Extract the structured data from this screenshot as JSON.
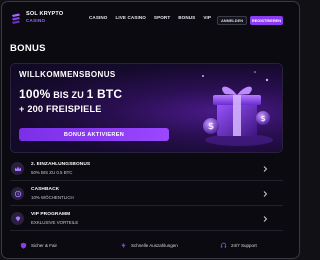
{
  "header": {
    "logo_name": "SOL KRYPTO",
    "logo_sub": "CASINO",
    "nav": [
      "CASINO",
      "LIVE CASINO",
      "SPORT",
      "BONUS",
      "VIP"
    ],
    "login_label": "ANMELDEN",
    "register_label": "REGISTRIEREN"
  },
  "page_title": "BONUS",
  "hero": {
    "title": "WILLKOMMENSBONUS",
    "line1_a": "100%",
    "line1_b": " BIS ZU ",
    "line1_c": "1 BTC",
    "line2": "+ 200 FREISPIELE",
    "cta_label": "BONUS AKTIVIEREN"
  },
  "offers": [
    {
      "title": "2. EINZAHLUNGSBONUS",
      "subtitle": "50% BIS ZU 0.5 BTC",
      "icon": "crown-icon"
    },
    {
      "title": "CASHBACK",
      "subtitle": "10% WÖCHENTLICH",
      "icon": "cashback-icon"
    },
    {
      "title": "VIP PROGRAMM",
      "subtitle": "EXKLUSIVE VORTEILE",
      "icon": "diamond-icon"
    }
  ],
  "footer": {
    "items": [
      "Sicher & Fair",
      "Schnelle Auszahlungen",
      "24/7 Support"
    ]
  },
  "colors": {
    "accent": "#8b3cf0",
    "background": "#0a0a10"
  }
}
